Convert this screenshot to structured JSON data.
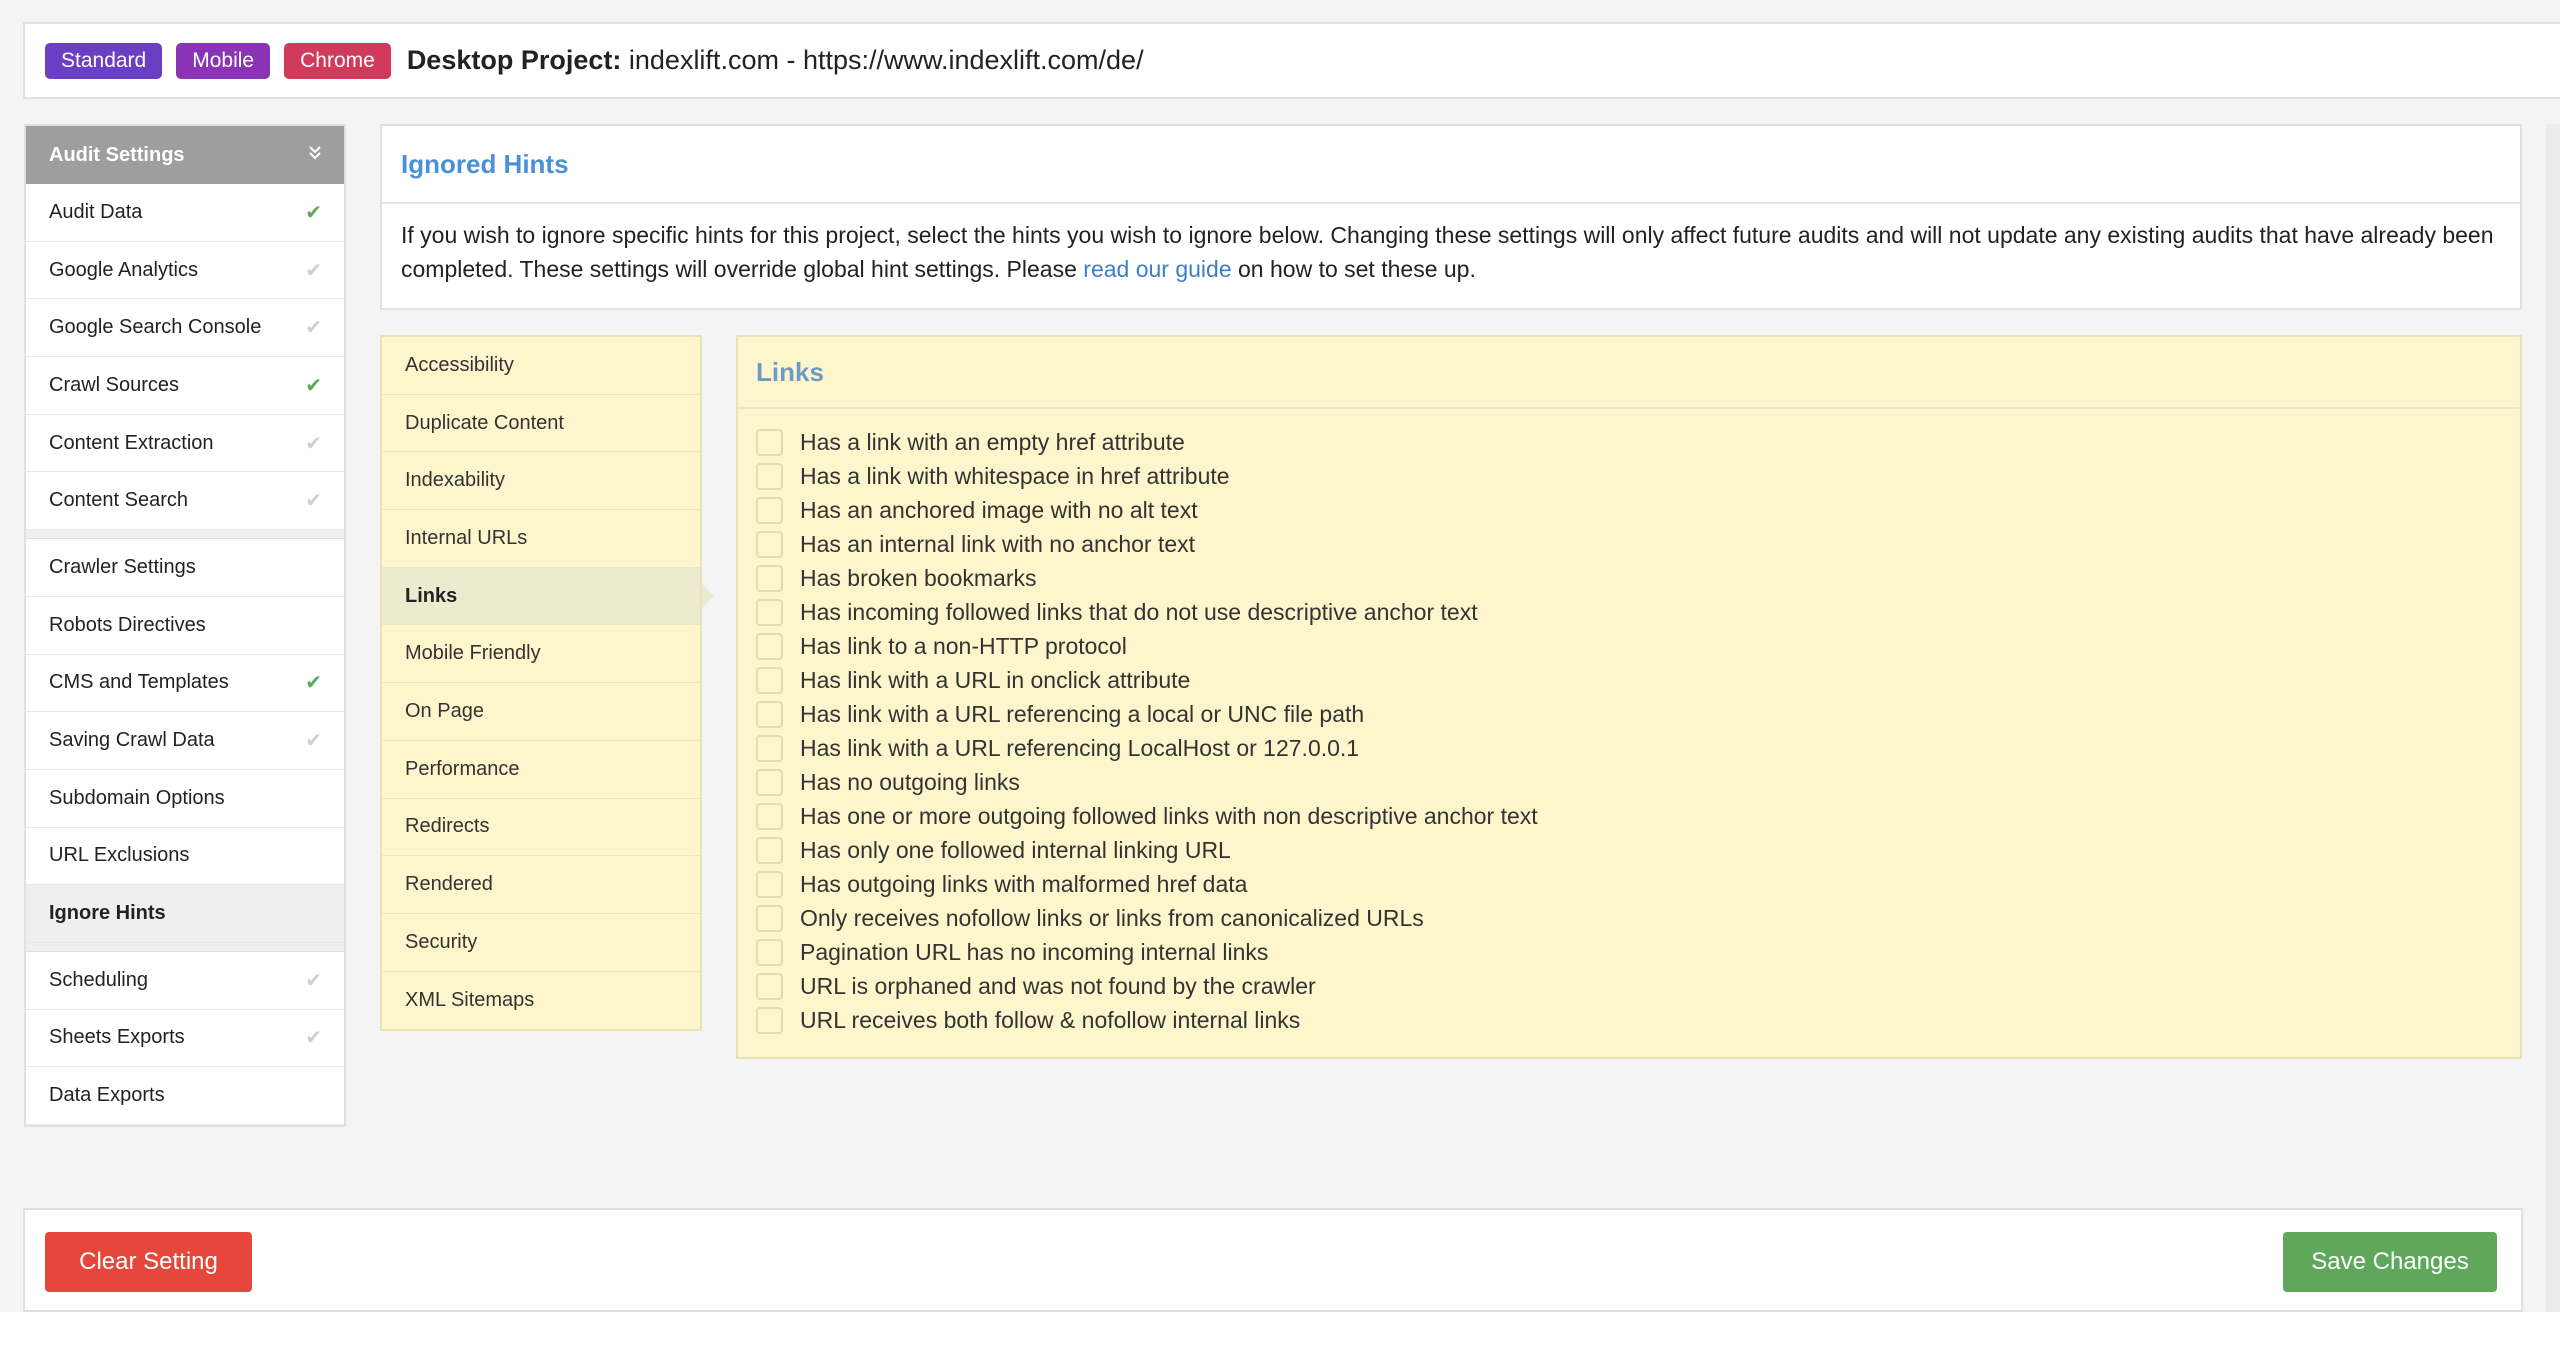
{
  "header": {
    "tags": [
      "Standard",
      "Mobile",
      "Chrome"
    ],
    "project_label": "Desktop Project:",
    "project_value": "indexlift.com - https://www.indexlift.com/de/"
  },
  "sidebar": {
    "title": "Audit Settings",
    "group1": [
      {
        "label": "Audit Data",
        "check": "green"
      },
      {
        "label": "Google Analytics",
        "check": "grey"
      },
      {
        "label": "Google Search Console",
        "check": "grey"
      },
      {
        "label": "Crawl Sources",
        "check": "green"
      },
      {
        "label": "Content Extraction",
        "check": "grey"
      },
      {
        "label": "Content Search",
        "check": "grey"
      }
    ],
    "group2": [
      {
        "label": "Crawler Settings",
        "check": ""
      },
      {
        "label": "Robots Directives",
        "check": ""
      },
      {
        "label": "CMS and Templates",
        "check": "green"
      },
      {
        "label": "Saving Crawl Data",
        "check": "grey"
      },
      {
        "label": "Subdomain Options",
        "check": ""
      },
      {
        "label": "URL Exclusions",
        "check": ""
      },
      {
        "label": "Ignore Hints",
        "check": ""
      }
    ],
    "group3": [
      {
        "label": "Scheduling",
        "check": "grey"
      },
      {
        "label": "Sheets Exports",
        "check": "grey"
      },
      {
        "label": "Data Exports",
        "check": ""
      }
    ]
  },
  "ignored_hints": {
    "title": "Ignored Hints",
    "desc_before": "If you wish to ignore specific hints for this project, select the hints you wish to ignore below. Changing these settings will only affect future audits and will not update any existing audits that have already been completed. These settings will override global hint settings. Please ",
    "link": "read our guide",
    "desc_after": " on how to set these up."
  },
  "categories": [
    "Accessibility",
    "Duplicate Content",
    "Indexability",
    "Internal URLs",
    "Links",
    "Mobile Friendly",
    "On Page",
    "Performance",
    "Redirects",
    "Rendered",
    "Security",
    "XML Sitemaps"
  ],
  "active_category": "Links",
  "links": {
    "title": "Links",
    "hints": [
      "Has a link with an empty href attribute",
      "Has a link with whitespace in href attribute",
      "Has an anchored image with no alt text",
      "Has an internal link with no anchor text",
      "Has broken bookmarks",
      "Has incoming followed links that do not use descriptive anchor text",
      "Has link to a non-HTTP protocol",
      "Has link with a URL in onclick attribute",
      "Has link with a URL referencing a local or UNC file path",
      "Has link with a URL referencing LocalHost or 127.0.0.1",
      "Has no outgoing links",
      "Has one or more outgoing followed links with non descriptive anchor text",
      "Has only one followed internal linking URL",
      "Has outgoing links with malformed href data",
      "Only receives nofollow links or links from canonicalized URLs",
      "Pagination URL has no incoming internal links",
      "URL is orphaned and was not found by the crawler",
      "URL receives both follow & nofollow internal links"
    ]
  },
  "footer": {
    "clear_label": "Clear Setting",
    "save_label": "Save Changes"
  },
  "icons": {
    "check": "check-icon",
    "collapse": "double-chevron-down-icon"
  },
  "colors": {
    "accent_blue": "#4a90d9",
    "check_green": "#5aa95a",
    "clear_red": "#e5473a",
    "save_green": "#5fa75a"
  }
}
